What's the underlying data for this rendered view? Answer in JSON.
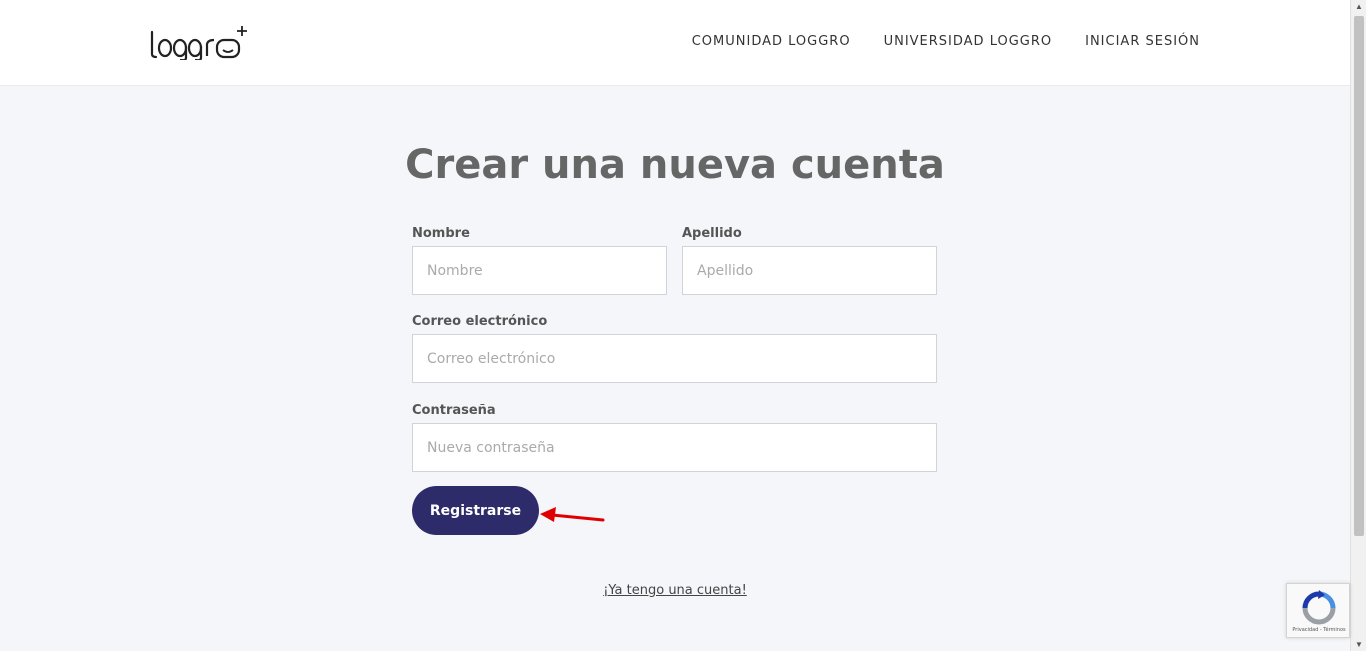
{
  "header": {
    "logo_text": "loggro+",
    "nav": [
      {
        "label": "COMUNIDAD LOGGRO"
      },
      {
        "label": "UNIVERSIDAD LOGGRO"
      },
      {
        "label": "INICIAR SESIÓN"
      }
    ]
  },
  "form": {
    "title": "Crear una nueva cuenta",
    "first_name": {
      "label": "Nombre",
      "placeholder": "Nombre",
      "value": ""
    },
    "last_name": {
      "label": "Apellido",
      "placeholder": "Apellido",
      "value": ""
    },
    "email": {
      "label": "Correo electrónico",
      "placeholder": "Correo electrónico",
      "value": ""
    },
    "password": {
      "label": "Contraseña",
      "placeholder": "Nueva contraseña",
      "value": ""
    },
    "submit_label": "Registrarse",
    "login_link": "¡Ya tengo una cuenta!"
  },
  "recaptcha": {
    "footer_text": "Privacidad - Términos"
  },
  "colors": {
    "primary_button": "#2e2b6b",
    "annotation_arrow": "#e00000",
    "page_background": "#f4f6f9"
  }
}
